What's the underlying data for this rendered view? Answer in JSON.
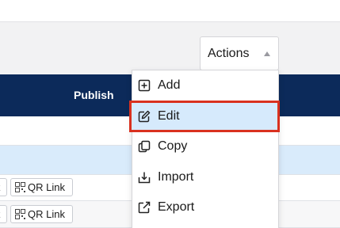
{
  "actions": {
    "label": "Actions"
  },
  "table": {
    "header": {
      "publish_label": "Publish"
    },
    "row_buttons": {
      "qr_label": "QR Link"
    }
  },
  "menu": {
    "items": [
      {
        "label": "Add",
        "icon": "plus-square-icon"
      },
      {
        "label": "Edit",
        "icon": "edit-icon",
        "highlighted": true
      },
      {
        "label": "Copy",
        "icon": "copy-icon"
      },
      {
        "label": "Import",
        "icon": "import-icon"
      },
      {
        "label": "Export",
        "icon": "export-icon"
      }
    ]
  },
  "colors": {
    "header_bg": "#0c2a5a",
    "highlight_bg": "#d6eafc",
    "highlight_border": "#d9311f",
    "selected_row": "#d9ebfb"
  }
}
